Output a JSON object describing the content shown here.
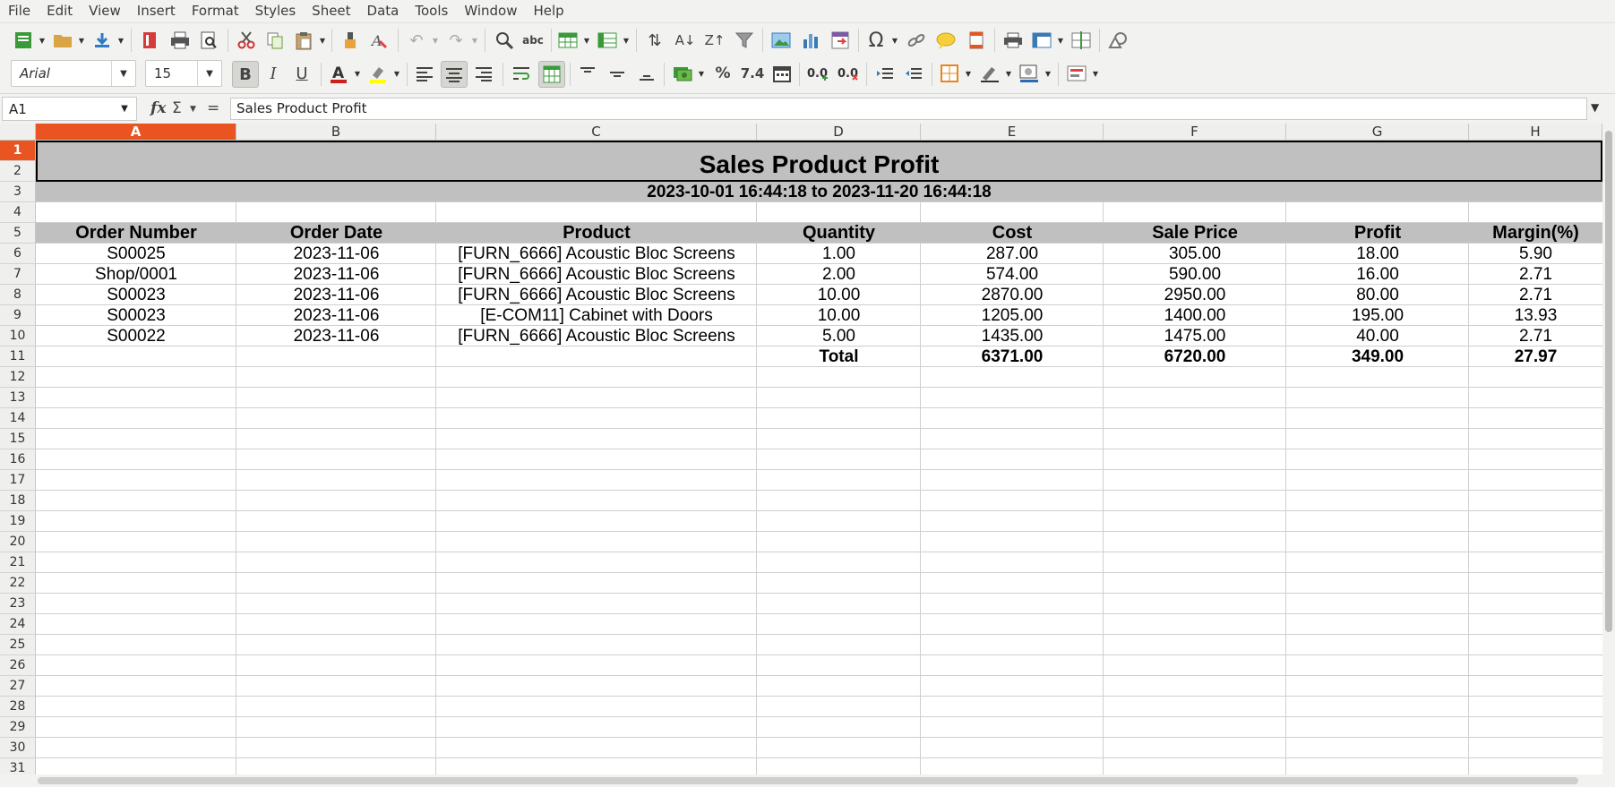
{
  "menubar": [
    "File",
    "Edit",
    "View",
    "Insert",
    "Format",
    "Styles",
    "Sheet",
    "Data",
    "Tools",
    "Window",
    "Help"
  ],
  "toolbar": {
    "font_name": "Arial",
    "font_size": "15",
    "icons": {
      "new": "new-document-icon",
      "open": "open-folder-icon",
      "save": "save-icon",
      "export_pdf": "export-pdf-icon",
      "print": "print-icon",
      "print_preview": "print-preview-icon",
      "cut": "cut-icon",
      "copy": "copy-icon",
      "paste": "paste-icon",
      "clone": "clone-formatting-icon",
      "clear": "clear-formatting-icon",
      "undo": "undo-icon",
      "redo": "redo-icon",
      "find": "find-replace-icon",
      "spelling": "spelling-icon",
      "row": "row-icon",
      "column": "column-icon",
      "sort": "sort-icon",
      "sort_asc": "sort-ascending-icon",
      "sort_desc": "sort-descending-icon",
      "autofilter": "autofilter-icon",
      "image": "image-icon",
      "chart": "chart-icon",
      "pivot": "pivot-table-icon",
      "special_char": "special-character-icon",
      "hyperlink": "hyperlink-icon",
      "comment": "comment-icon",
      "header_footer": "header-footer-icon",
      "print_area": "print-area-icon",
      "freeze": "freeze-rows-columns-icon",
      "split": "split-window-icon",
      "shapes": "shapes-icon",
      "bold": "bold-icon",
      "italic": "italic-icon",
      "underline": "underline-icon",
      "font_color": "font-color-icon",
      "highlight": "highlight-color-icon",
      "align_left": "align-left-icon",
      "align_center": "align-center-icon",
      "align_right": "align-right-icon",
      "wrap": "wrap-text-icon",
      "merge": "merge-cells-icon",
      "align_top": "align-top-icon",
      "align_middle": "align-middle-icon",
      "align_bottom": "align-bottom-icon",
      "currency": "currency-format-icon",
      "percent": "percent-format-icon",
      "number": "number-format-icon",
      "date": "date-format-icon",
      "add_decimal": "add-decimal-icon",
      "delete_decimal": "delete-decimal-icon",
      "increase_indent": "increase-indent-icon",
      "decrease_indent": "decrease-indent-icon",
      "borders": "borders-icon",
      "border_style": "border-style-icon",
      "border_color": "border-color-icon",
      "conditional": "conditional-format-icon"
    },
    "labels": {
      "percent": "%",
      "number": "7.4",
      "special_char": "Ω",
      "bold": "B",
      "italic": "I",
      "underline": "U",
      "spelling": "abc"
    }
  },
  "formula_bar": {
    "cell_ref": "A1",
    "fx": "fx",
    "sigma": "Σ",
    "equals": "=",
    "content": "Sales Product Profit"
  },
  "columns": [
    "A",
    "B",
    "C",
    "D",
    "E",
    "F",
    "G",
    "H"
  ],
  "selected_column": "A",
  "rows": [
    "1",
    "2",
    "3",
    "4",
    "5",
    "6",
    "7",
    "8",
    "9",
    "10",
    "11",
    "12",
    "13",
    "14",
    "15",
    "16",
    "17",
    "18",
    "19",
    "20",
    "21",
    "22",
    "23",
    "24",
    "25",
    "26",
    "27",
    "28",
    "29",
    "30",
    "31"
  ],
  "selected_row": "1",
  "sheet": {
    "title": "Sales Product Profit",
    "date_range": "2023-10-01 16:44:18 to 2023-11-20 16:44:18",
    "headers": [
      "Order Number",
      "Order Date",
      "Product",
      "Quantity",
      "Cost",
      "Sale Price",
      "Profit",
      "Margin(%)"
    ],
    "data": [
      [
        "S00025",
        "2023-11-06",
        "[FURN_6666] Acoustic Bloc Screens",
        "1.00",
        "287.00",
        "305.00",
        "18.00",
        "5.90"
      ],
      [
        "Shop/0001",
        "2023-11-06",
        "[FURN_6666] Acoustic Bloc Screens",
        "2.00",
        "574.00",
        "590.00",
        "16.00",
        "2.71"
      ],
      [
        "S00023",
        "2023-11-06",
        "[FURN_6666] Acoustic Bloc Screens",
        "10.00",
        "2870.00",
        "2950.00",
        "80.00",
        "2.71"
      ],
      [
        "S00023",
        "2023-11-06",
        "[E-COM11] Cabinet with Doors",
        "10.00",
        "1205.00",
        "1400.00",
        "195.00",
        "13.93"
      ],
      [
        "S00022",
        "2023-11-06",
        "[FURN_6666] Acoustic Bloc Screens",
        "5.00",
        "1435.00",
        "1475.00",
        "40.00",
        "2.71"
      ]
    ],
    "total": [
      "",
      "",
      "",
      "Total",
      "6371.00",
      "6720.00",
      "349.00",
      "27.97"
    ]
  },
  "colors": {
    "selection": "#e95420",
    "band": "#c0c0c0",
    "chrome": "#f2f2f1"
  }
}
